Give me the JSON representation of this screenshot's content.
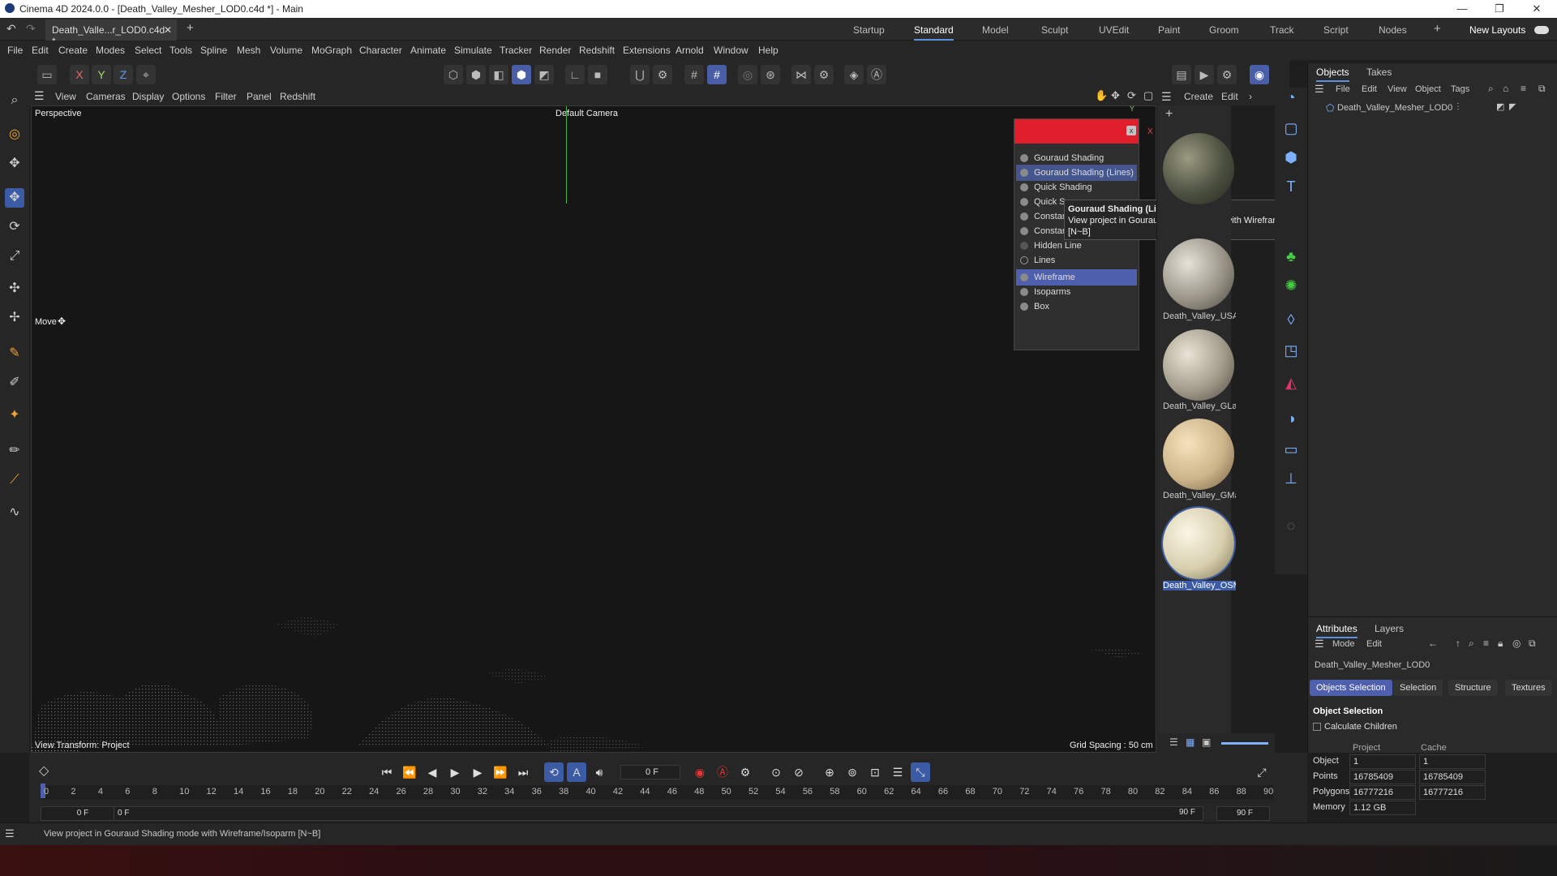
{
  "window": {
    "title": "Cinema 4D 2024.0.0 - [Death_Valley_Mesher_LOD0.c4d *] - Main",
    "minimize": "—",
    "restore": "❐",
    "close": "✕"
  },
  "tabs": {
    "document_tab": "Death_Valle...r_LOD0.c4d *",
    "add_tab": "+",
    "layouts": [
      "Startup",
      "Standard",
      "Model",
      "Sculpt",
      "UVEdit",
      "Paint",
      "Groom",
      "Track",
      "Script",
      "Nodes"
    ],
    "active_layout": "Standard",
    "new_layouts": "New Layouts"
  },
  "menu": [
    "File",
    "Edit",
    "Create",
    "Modes",
    "Select",
    "Tools",
    "Spline",
    "Mesh",
    "Volume",
    "MoGraph",
    "Character",
    "Animate",
    "Simulate",
    "Tracker",
    "Render",
    "Redshift",
    "Extensions",
    "Arnold",
    "Window",
    "Help"
  ],
  "toolbar": {
    "axes": [
      "X",
      "Y",
      "Z"
    ]
  },
  "viewport_menu": [
    "View",
    "Cameras",
    "Display",
    "Options",
    "Filter",
    "Panel",
    "Redshift"
  ],
  "viewport": {
    "name": "Perspective",
    "camera": "Default Camera",
    "tool": "Move",
    "view_transform": "View Transform: Project",
    "grid_spacing": "Grid Spacing : 50 cm",
    "axis_y": "Y",
    "axis_x": "X"
  },
  "shading_menu": {
    "close": "x",
    "items": [
      "Gouraud Shading",
      "Gouraud Shading (Lines)",
      "Quick Shading",
      "Quick Shading (Lines)",
      "Constant Shading",
      "Constant Shading (Lines)",
      "Hidden Line",
      "Lines",
      "Wireframe",
      "Isoparms",
      "Box"
    ],
    "hovered": "Gouraud Shading (Lines)",
    "selected": "Wireframe",
    "item_labels_visible": [
      "Gouraud Shading",
      "Gouraud Shading (Lines)",
      "Quick Shading",
      "Quick S",
      "Constan",
      "Constant Shading (Lines)",
      "Hidden Line",
      "Lines",
      "Wireframe",
      "Isoparms",
      "Box"
    ]
  },
  "tooltip": {
    "title": "Gouraud Shading (Lines)",
    "text": "View project in Gouraud Shading  mode with Wireframe/Isoparm",
    "shortcut": "[N~B]"
  },
  "materials": {
    "menu": [
      "Create",
      "Edit"
    ],
    "items": [
      "Death_Valley_USA",
      "Death_Valley_GLa",
      "Death_Valley_GMa",
      "Death_Valley_OSM"
    ]
  },
  "objects_panel": {
    "tabs": [
      "Objects",
      "Takes"
    ],
    "menu": [
      "File",
      "Edit",
      "View",
      "Object",
      "Tags"
    ],
    "object_name": "Death_Valley_Mesher_LOD0"
  },
  "attributes_panel": {
    "tabs": [
      "Attributes",
      "Layers"
    ],
    "menu": [
      "Mode",
      "Edit"
    ],
    "object_name": "Death_Valley_Mesher_LOD0",
    "subtabs": [
      "Objects Selection",
      "Selection",
      "Structure",
      "Textures"
    ],
    "section": "Object Selection",
    "checkbox": "Calculate Children",
    "columns": [
      "Project",
      "Cache"
    ],
    "rows": [
      {
        "label": "Object",
        "project": "1",
        "cache": "1"
      },
      {
        "label": "Points",
        "project": "16785409",
        "cache": "16785409"
      },
      {
        "label": "Polygons",
        "project": "16777216",
        "cache": "16777216"
      },
      {
        "label": "Memory",
        "project": "1.12 GB",
        "cache": ""
      }
    ]
  },
  "timeline": {
    "current_frame": "0 F",
    "ticks": [
      "0",
      "2",
      "4",
      "6",
      "8",
      "10",
      "12",
      "14",
      "16",
      "18",
      "20",
      "22",
      "24",
      "26",
      "28",
      "30",
      "32",
      "34",
      "36",
      "38",
      "40",
      "42",
      "44",
      "46",
      "48",
      "50",
      "52",
      "54",
      "56",
      "58",
      "60",
      "62",
      "64",
      "66",
      "68",
      "70",
      "72",
      "74",
      "76",
      "78",
      "80",
      "82",
      "84",
      "86",
      "88",
      "90"
    ],
    "start_a": "0 F",
    "start_b": "0 F",
    "end_a": "90 F",
    "end_b": "90 F"
  },
  "statusbar": {
    "text": "View project in Gouraud Shading  mode with Wireframe/Isoparm [N~B]"
  }
}
